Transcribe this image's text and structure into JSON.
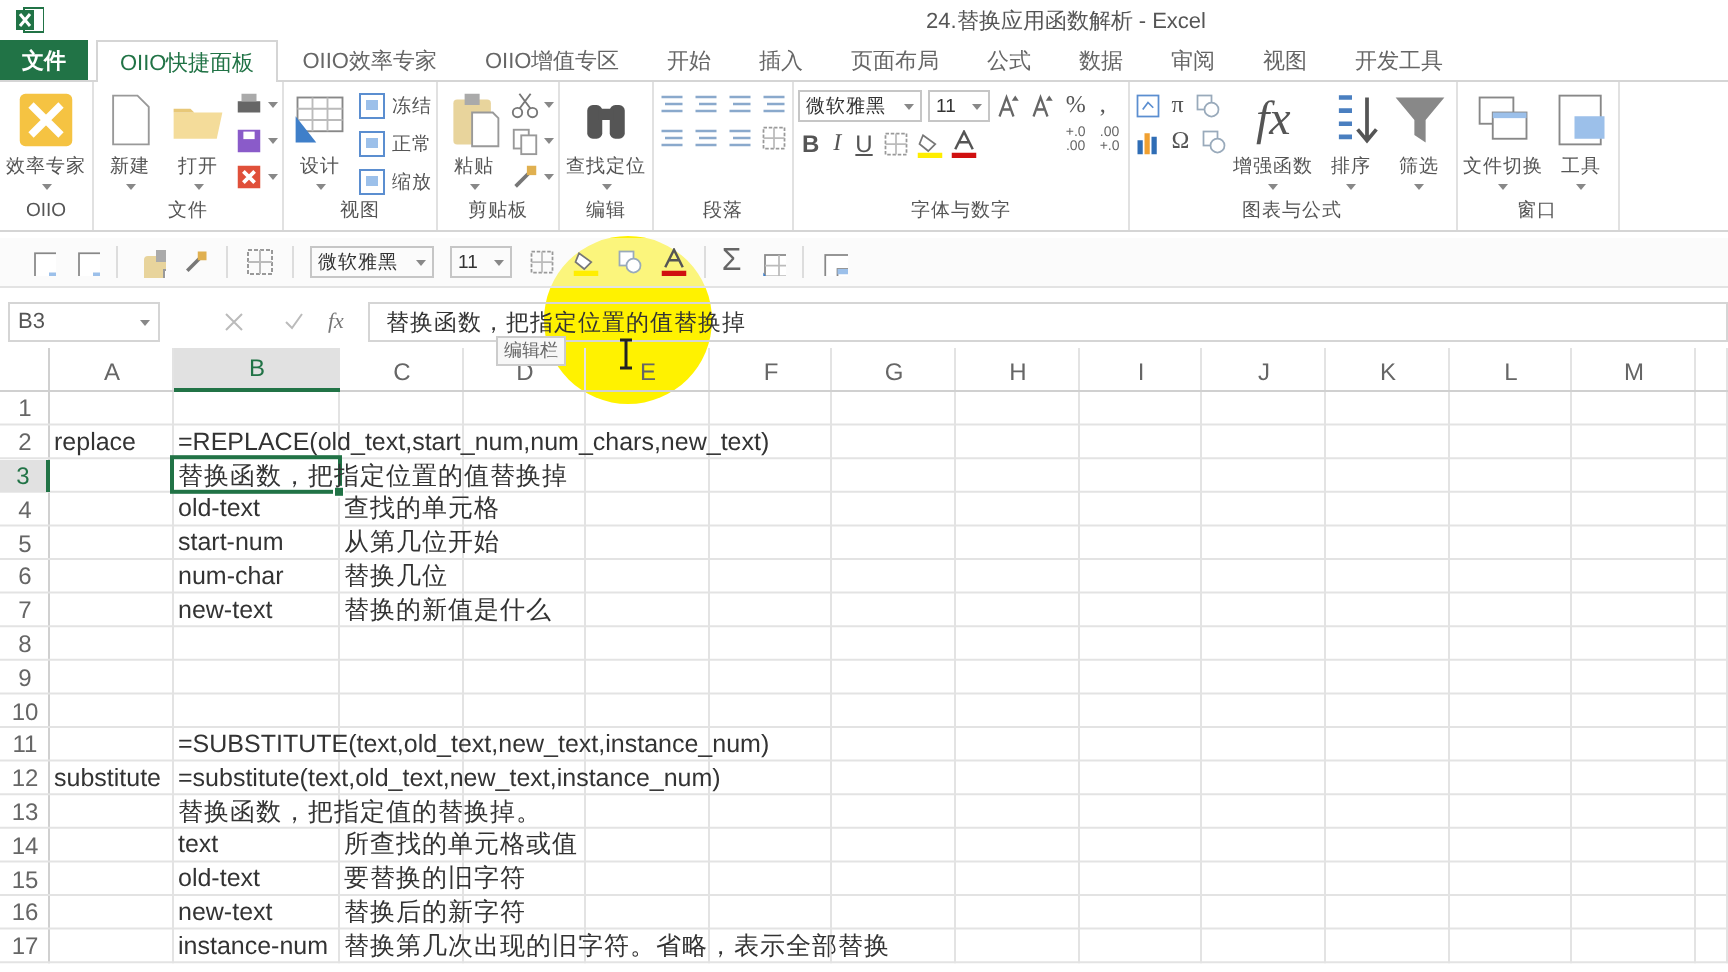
{
  "window": {
    "title": "24.替换应用函数解析 - Excel"
  },
  "tabs": [
    {
      "label": "文件",
      "kind": "file",
      "selected": false
    },
    {
      "label": "OIIO快捷面板",
      "kind": "tab",
      "selected": true
    },
    {
      "label": "OIIO效率专家",
      "kind": "tab",
      "selected": false
    },
    {
      "label": "OIIO增值专区",
      "kind": "tab",
      "selected": false
    },
    {
      "label": "开始",
      "kind": "tab",
      "selected": false
    },
    {
      "label": "插入",
      "kind": "tab",
      "selected": false
    },
    {
      "label": "页面布局",
      "kind": "tab",
      "selected": false
    },
    {
      "label": "公式",
      "kind": "tab",
      "selected": false
    },
    {
      "label": "数据",
      "kind": "tab",
      "selected": false
    },
    {
      "label": "审阅",
      "kind": "tab",
      "selected": false
    },
    {
      "label": "视图",
      "kind": "tab",
      "selected": false
    },
    {
      "label": "开发工具",
      "kind": "tab",
      "selected": false
    }
  ],
  "ribbon": [
    {
      "label": "OIIO",
      "items": [
        {
          "kind": "large",
          "label": "效率专家",
          "dropdown": true
        }
      ]
    },
    {
      "label": "文件",
      "items": [
        {
          "kind": "large",
          "label": "新建",
          "dropdown": true
        },
        {
          "kind": "large",
          "label": "打开",
          "dropdown": true
        },
        {
          "kind": "icon-column"
        }
      ]
    },
    {
      "label": "视图",
      "items": [
        {
          "kind": "large",
          "label": "设计",
          "dropdown": true
        },
        {
          "kind": "column",
          "items": [
            {
              "kind": "small",
              "label": "冻结"
            },
            {
              "kind": "small",
              "label": "正常"
            },
            {
              "kind": "small",
              "label": "缩放"
            }
          ]
        }
      ]
    },
    {
      "label": "剪贴板",
      "items": [
        {
          "kind": "large",
          "label": "粘贴",
          "dropdown": true
        },
        {
          "kind": "icon-column"
        }
      ]
    },
    {
      "label": "编辑",
      "items": [
        {
          "kind": "large",
          "label": "查找定位",
          "dropdown": true
        }
      ]
    },
    {
      "label": "段落",
      "items": [
        {
          "kind": "column",
          "items": [
            {
              "kind": "row",
              "items": [
                {
                  "kind": "icon"
                },
                {
                  "kind": "icon"
                },
                {
                  "kind": "icon"
                },
                {
                  "kind": "icon"
                }
              ]
            },
            {
              "kind": "row",
              "items": [
                {
                  "kind": "icon"
                },
                {
                  "kind": "icon"
                },
                {
                  "kind": "icon"
                },
                {
                  "kind": "icon"
                }
              ]
            }
          ]
        }
      ]
    },
    {
      "label": "字体与数字",
      "items": [
        {
          "kind": "column",
          "items": [
            {
              "kind": "row",
              "items": [
                {
                  "kind": "field",
                  "value": "微软雅黑"
                },
                {
                  "kind": "field",
                  "value": "11"
                },
                {
                  "kind": "icon"
                },
                {
                  "kind": "icon"
                }
              ]
            },
            {
              "kind": "row",
              "items": [
                {
                  "kind": "bold",
                  "text": "B"
                },
                {
                  "kind": "italic",
                  "text": "I"
                },
                {
                  "kind": "underline",
                  "text": "U"
                },
                {
                  "kind": "icon"
                },
                {
                  "kind": "icon"
                },
                {
                  "kind": "icon"
                }
              ]
            }
          ]
        },
        {
          "kind": "column",
          "items": [
            {
              "kind": "row",
              "items": [
                {
                  "kind": "glyph",
                  "text": "%"
                },
                {
                  "kind": "glyph",
                  "text": ","
                }
              ]
            },
            {
              "kind": "row",
              "items": [
                {
                  "kind": "stack",
                  "top": "+.0",
                  "bottom": ".00"
                },
                {
                  "kind": "stack",
                  "top": ".00",
                  "bottom": "+.0"
                }
              ]
            }
          ]
        }
      ]
    },
    {
      "label": "图表与公式",
      "items": [
        {
          "kind": "column",
          "items": [
            {
              "kind": "row",
              "items": [
                {
                  "kind": "icon"
                },
                {
                  "kind": "glyph",
                  "text": "π"
                },
                {
                  "kind": "icon"
                }
              ]
            },
            {
              "kind": "row",
              "items": [
                {
                  "kind": "icon"
                },
                {
                  "kind": "glyph",
                  "text": "Ω"
                },
                {
                  "kind": "icon"
                }
              ]
            }
          ]
        },
        {
          "kind": "large-glyph",
          "glyph": "fx",
          "label": "增强函数",
          "dropdown": true
        },
        {
          "kind": "large",
          "label": "排序",
          "dropdown": true
        },
        {
          "kind": "large",
          "label": "筛选",
          "dropdown": true
        }
      ]
    },
    {
      "label": "窗口",
      "items": [
        {
          "kind": "large",
          "label": "文件切换",
          "dropdown": true
        },
        {
          "kind": "large",
          "label": "工具",
          "dropdown": true
        }
      ]
    }
  ],
  "quick_toolbar": {
    "font": "微软雅黑",
    "size": "11",
    "sum": "Σ"
  },
  "formula_bar": {
    "name_box": "B3",
    "function_glyph": "fx",
    "content": "替换函数，把指定位置的值替换掉",
    "tooltip": "编辑栏"
  },
  "sheet": {
    "columns": [
      {
        "label": "A",
        "selected": false
      },
      {
        "label": "B",
        "selected": true
      },
      {
        "label": "C",
        "selected": false
      },
      {
        "label": "D",
        "selected": false
      },
      {
        "label": "E",
        "selected": false
      },
      {
        "label": "F",
        "selected": false
      },
      {
        "label": "G",
        "selected": false
      },
      {
        "label": "H",
        "selected": false
      },
      {
        "label": "I",
        "selected": false
      },
      {
        "label": "J",
        "selected": false
      },
      {
        "label": "K",
        "selected": false
      },
      {
        "label": "L",
        "selected": false
      },
      {
        "label": "M",
        "selected": false
      }
    ],
    "rows": [
      {
        "header": "1",
        "selected": false
      },
      {
        "header": "2",
        "selected": false,
        "cells": {
          "A": "replace",
          "B": "=REPLACE(old_text,start_num,num_chars,new_text)"
        }
      },
      {
        "header": "3",
        "selected": true,
        "cells": {
          "B": "替换函数，把指定位置的值替换掉"
        }
      },
      {
        "header": "4",
        "selected": false,
        "cells": {
          "B": "old-text",
          "C": "查找的单元格"
        }
      },
      {
        "header": "5",
        "selected": false,
        "cells": {
          "B": "start-num",
          "C": "从第几位开始"
        }
      },
      {
        "header": "6",
        "selected": false,
        "cells": {
          "B": "num-char",
          "C": "替换几位"
        }
      },
      {
        "header": "7",
        "selected": false,
        "cells": {
          "B": "new-text",
          "C": "替换的新值是什么"
        }
      },
      {
        "header": "8",
        "selected": false
      },
      {
        "header": "9",
        "selected": false
      },
      {
        "header": "10",
        "selected": false
      },
      {
        "header": "11",
        "selected": false,
        "cells": {
          "B": "=SUBSTITUTE(text,old_text,new_text,instance_num)"
        }
      },
      {
        "header": "12",
        "selected": false,
        "cells": {
          "A": "substitute",
          "B": "=substitute(text,old_text,new_text,instance_num)"
        }
      },
      {
        "header": "13",
        "selected": false,
        "cells": {
          "B": "替换函数，把指定值的替换掉。"
        }
      },
      {
        "header": "14",
        "selected": false,
        "cells": {
          "B": "text",
          "C": "所查找的单元格或值"
        }
      },
      {
        "header": "15",
        "selected": false,
        "cells": {
          "B": "old-text",
          "C": "要替换的旧字符"
        }
      },
      {
        "header": "16",
        "selected": false,
        "cells": {
          "B": "new-text",
          "C": "替换后的新字符"
        }
      },
      {
        "header": "17",
        "selected": false,
        "cells": {
          "B": "instance-num",
          "C": "替换第几次出现的旧字符。省略，表示全部替换"
        }
      }
    ]
  }
}
